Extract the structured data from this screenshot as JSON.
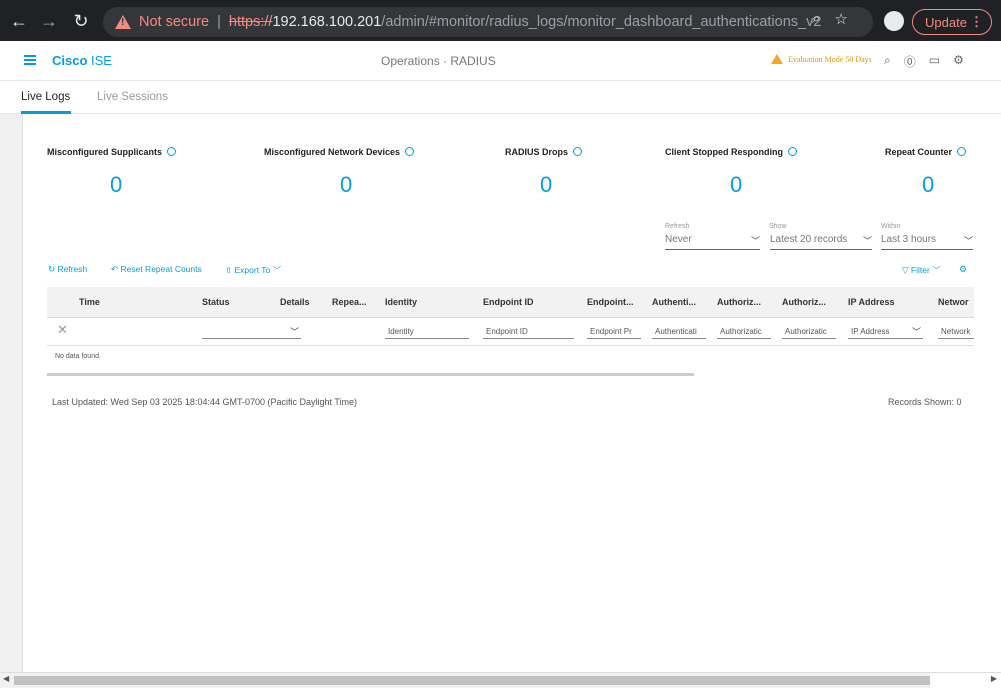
{
  "browser": {
    "security_label": "Not secure",
    "url_scheme": "https://",
    "url_host": "192.168.100.201",
    "url_path": "/admin/#monitor/radius_logs/monitor_dashboard_authentications_v2",
    "update_label": "Update",
    "icons": [
      "back-icon",
      "forward-icon",
      "reload-icon",
      "warning-icon",
      "zoom-icon",
      "star-icon",
      "avatar",
      "more-icon"
    ]
  },
  "header": {
    "brand_bold": "Cisco",
    "brand_rest": " ISE",
    "breadcrumb": "Operations · RADIUS",
    "eval_text": "Evaluation Mode 50 Days",
    "accent_color": "#049fd9",
    "warn_color": "#f5a623"
  },
  "tabs": [
    {
      "label": "Live Logs",
      "active": true
    },
    {
      "label": "Live Sessions",
      "active": false
    }
  ],
  "metrics": [
    {
      "label": "Misconfigured Supplicants",
      "value": "0"
    },
    {
      "label": "Misconfigured Network Devices",
      "value": "0"
    },
    {
      "label": "RADIUS Drops",
      "value": "0"
    },
    {
      "label": "Client Stopped Responding",
      "value": "0"
    },
    {
      "label": "Repeat Counter",
      "value": "0"
    }
  ],
  "controls": {
    "refresh_label": "Refresh",
    "refresh_value": "Never",
    "show_label": "Show",
    "show_value": "Latest 20 records",
    "within_label": "Within",
    "within_value": "Last 3 hours"
  },
  "toolbar": {
    "refresh": "Refresh",
    "reset": "Reset Repeat Counts",
    "export": "Export To",
    "filter": "Filter"
  },
  "table": {
    "columns": [
      "Time",
      "Status",
      "Details",
      "Repea...",
      "Identity",
      "Endpoint ID",
      "Endpoint...",
      "Authenti...",
      "Authoriz...",
      "Authoriz...",
      "IP Address",
      "Networ"
    ],
    "filters": [
      "Identity",
      "Endpoint ID",
      "Endpoint Pr",
      "Authenticati",
      "Authorizatic",
      "Authorizatic",
      "IP Address",
      "Network"
    ],
    "empty_text": "No data found."
  },
  "footer": {
    "last_updated": "Last Updated: Wed Sep 03 2025 18:04:44 GMT-0700 (Pacific Daylight Time)",
    "records_shown": "Records Shown: 0"
  }
}
